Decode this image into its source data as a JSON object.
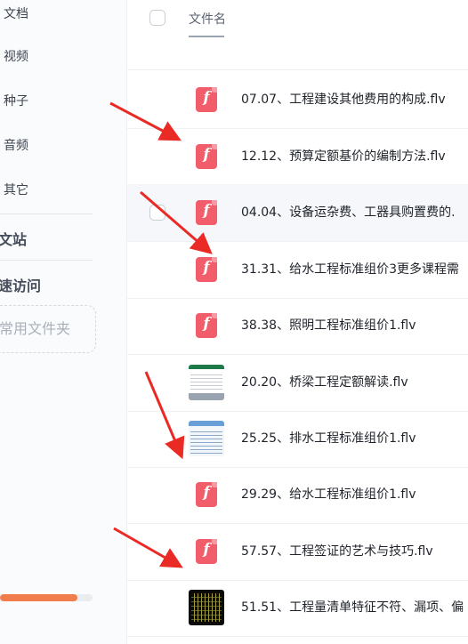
{
  "sidebar": {
    "items": [
      {
        "label": "文档"
      },
      {
        "label": "视频"
      },
      {
        "label": "种子"
      },
      {
        "label": "音频"
      },
      {
        "label": "其它"
      }
    ],
    "section1": "文站",
    "section2": "速访问",
    "add_folder_label": "常用文件夹",
    "storage_used_fraction": 0.84,
    "colors": {
      "progress": "#f17c4c"
    }
  },
  "file_list": {
    "column_header": "文件名",
    "rows": [
      {
        "name": "07.07、工程建设其他费用的构成.flv",
        "icon": "flv-file-icon"
      },
      {
        "name": "12.12、预算定额基价的编制方法.flv",
        "icon": "flv-file-icon"
      },
      {
        "name": "04.04、设备运杂费、工器具购置费的.",
        "icon": "flv-file-icon"
      },
      {
        "name": "31.31、给水工程标准组价3更多课程需",
        "icon": "flv-file-icon"
      },
      {
        "name": "38.38、照明工程标准组价1.flv",
        "icon": "flv-file-icon"
      },
      {
        "name": "20.20、桥梁工程定额解读.flv",
        "icon": "spreadsheet-thumbnail"
      },
      {
        "name": "25.25、排水工程标准组价1.flv",
        "icon": "document-thumbnail"
      },
      {
        "name": "29.29、给水工程标准组价1.flv",
        "icon": "flv-file-icon"
      },
      {
        "name": "57.57、工程签证的艺术与技巧.flv",
        "icon": "flv-file-icon"
      },
      {
        "name": "51.51、工程量清单特征不符、漏项、偏",
        "icon": "dark-video-thumbnail"
      }
    ],
    "flv_glyph": "f",
    "colors": {
      "flv_icon": "#f25d6c",
      "annotation_arrow": "#ea2a25"
    }
  }
}
